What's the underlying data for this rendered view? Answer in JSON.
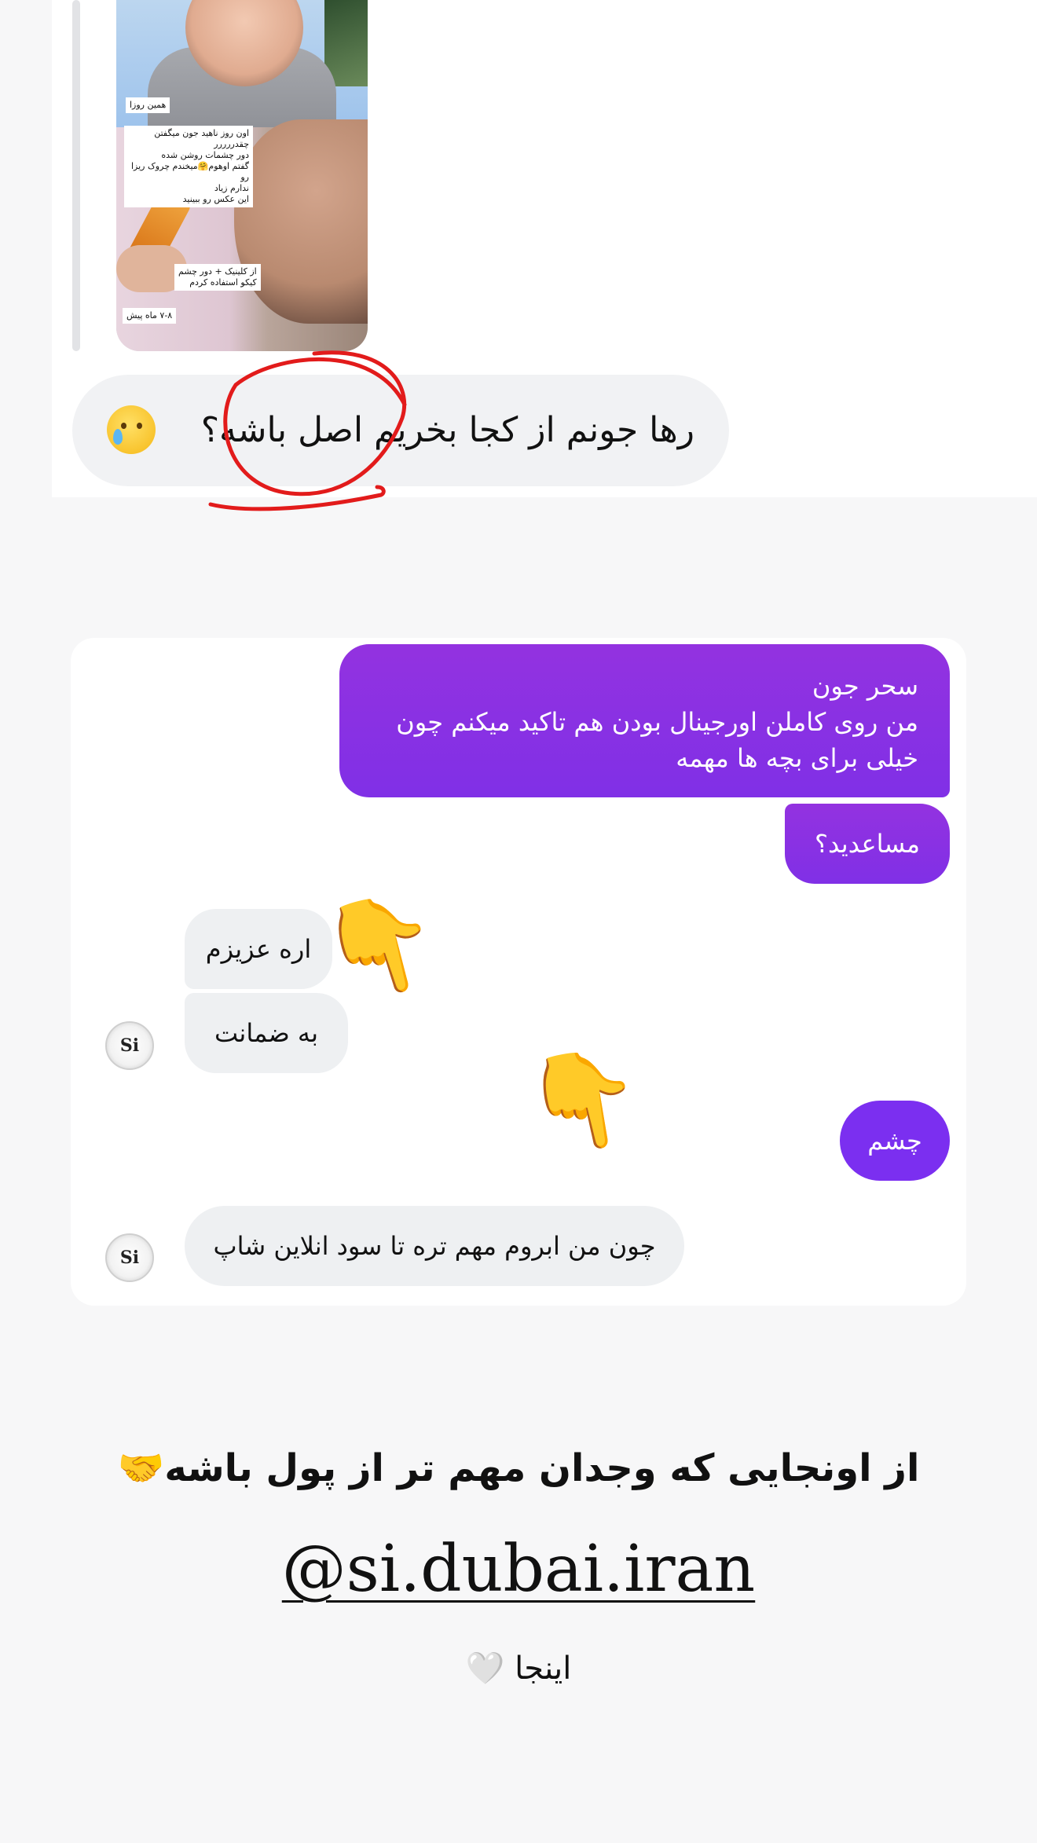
{
  "reply_card": {
    "media_tags": [
      "همین روزا",
      "اون روز ناهید جون میگفتن چقدررررر\nدور چشمات روشن شده\nگفتم اوهوم🤗میخندم چروک ریزا رو\nندارم زیاد\nاین عکس رو ببینید",
      "از کلینیک + دور چشم\nکیکو استفاده کردم",
      "۷-۸ ماه پیش"
    ],
    "message": "رها جونم از کجا بخریم اصل باشه؟"
  },
  "dm": {
    "messages": [
      {
        "side": "out",
        "text": "سحر جون\nمن روی کاملن اورجینال بودن هم تاکید میکنم چون\nخیلی برای بچه ها مهمه"
      },
      {
        "side": "out",
        "text": "مساعدید؟"
      },
      {
        "side": "in",
        "text": "اره عزیزم"
      },
      {
        "side": "in",
        "text": "به ضمانت"
      },
      {
        "side": "out",
        "text": "چشم"
      },
      {
        "side": "in",
        "text": "چون من ابروم مهم تره تا سود انلاین شاپ"
      }
    ],
    "avatar_text": "Si"
  },
  "caption": {
    "line1": "از اونجایی که وجدان مهم تر از پول باشه🤝",
    "handle": "@si.dubai.iran",
    "line3": "اینجا 🤍"
  },
  "colors": {
    "outgoing_bubble": "#8b2be3",
    "incoming_bubble": "#eef0f2",
    "annotation_red": "#e21b1b"
  }
}
